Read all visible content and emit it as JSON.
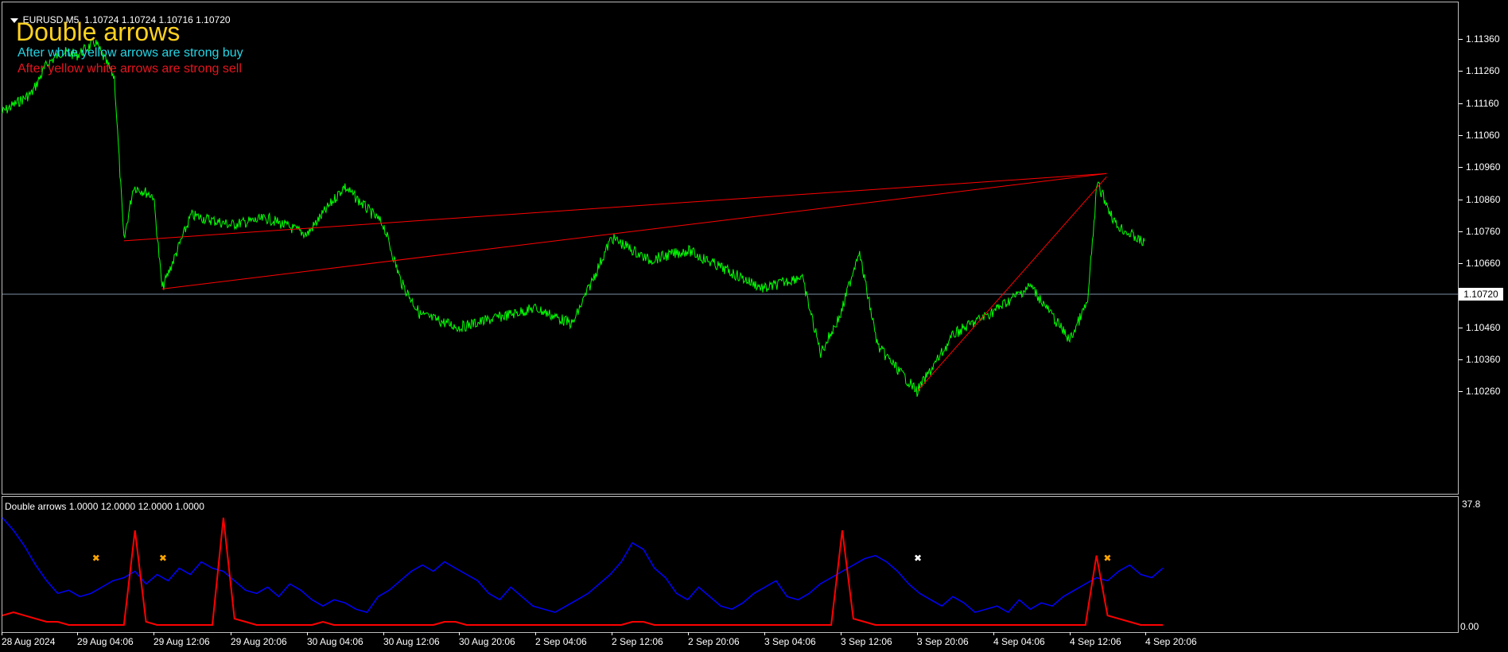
{
  "header": {
    "symbol": "EURUSD,M5",
    "ohlc": "1.10724 1.10724 1.10716 1.10720"
  },
  "overlay": {
    "title": "Double arrows",
    "buy_text": "After white yellow arrows are strong buy",
    "sell_text": "After yellow white arrows are strong sell"
  },
  "price_axis": [
    "1.11360",
    "1.11260",
    "1.11160",
    "1.11060",
    "1.10960",
    "1.10860",
    "1.10760",
    "1.10660",
    "1.10560",
    "1.10460",
    "1.10360",
    "1.10260"
  ],
  "current_price": "1.10720",
  "indicator": {
    "label": "Double arrows 1.0000 12.0000 12.0000 1.0000",
    "max_label": "37.8",
    "zero_label": "0.00"
  },
  "time_axis": [
    "28 Aug 2024",
    "29 Aug 04:06",
    "29 Aug 12:06",
    "29 Aug 20:06",
    "30 Aug 04:06",
    "30 Aug 12:06",
    "30 Aug 20:06",
    "2 Sep 04:06",
    "2 Sep 12:06",
    "2 Sep 20:06",
    "3 Sep 04:06",
    "3 Sep 12:06",
    "3 Sep 20:06",
    "4 Sep 04:06",
    "4 Sep 12:06",
    "4 Sep 20:06"
  ],
  "colors": {
    "price_line": "#00ff00",
    "trend_line": "#ff0000",
    "indicator_main": "#0000ff",
    "indicator_signal": "#ff0000",
    "arrow_yellow": "#ffa500",
    "arrow_white": "#ffffff",
    "grid_line": "#7a8fa6"
  },
  "chart_data": {
    "type": "line",
    "symbol": "EURUSD",
    "timeframe": "M5",
    "y_range": [
      1.1021,
      1.1142
    ],
    "price_series": [
      {
        "t": "28 Aug 2024",
        "p": 1.1113
      },
      {
        "t": "28 Aug 16:00",
        "p": 1.1119
      },
      {
        "t": "28 Aug 20:00",
        "p": 1.1128
      },
      {
        "t": "29 Aug 00:00",
        "p": 1.1132
      },
      {
        "t": "29 Aug 04:06",
        "p": 1.1131
      },
      {
        "t": "29 Aug 06:00",
        "p": 1.1135
      },
      {
        "t": "29 Aug 08:00",
        "p": 1.1124
      },
      {
        "t": "29 Aug 09:00",
        "p": 1.1073
      },
      {
        "t": "29 Aug 10:00",
        "p": 1.109
      },
      {
        "t": "29 Aug 12:06",
        "p": 1.1087
      },
      {
        "t": "29 Aug 13:00",
        "p": 1.1058
      },
      {
        "t": "29 Aug 16:00",
        "p": 1.1081
      },
      {
        "t": "29 Aug 20:06",
        "p": 1.1078
      },
      {
        "t": "30 Aug 00:00",
        "p": 1.108
      },
      {
        "t": "30 Aug 04:06",
        "p": 1.1075
      },
      {
        "t": "30 Aug 08:00",
        "p": 1.109
      },
      {
        "t": "30 Aug 12:06",
        "p": 1.1078
      },
      {
        "t": "30 Aug 14:00",
        "p": 1.106
      },
      {
        "t": "30 Aug 16:00",
        "p": 1.105
      },
      {
        "t": "30 Aug 20:06",
        "p": 1.1046
      },
      {
        "t": "2 Sep 04:06",
        "p": 1.1052
      },
      {
        "t": "2 Sep 08:00",
        "p": 1.1047
      },
      {
        "t": "2 Sep 12:06",
        "p": 1.1074
      },
      {
        "t": "2 Sep 16:00",
        "p": 1.1067
      },
      {
        "t": "2 Sep 20:06",
        "p": 1.107
      },
      {
        "t": "3 Sep 00:00",
        "p": 1.1064
      },
      {
        "t": "3 Sep 04:06",
        "p": 1.1058
      },
      {
        "t": "3 Sep 08:00",
        "p": 1.1062
      },
      {
        "t": "3 Sep 10:00",
        "p": 1.1038
      },
      {
        "t": "3 Sep 12:06",
        "p": 1.105
      },
      {
        "t": "3 Sep 14:00",
        "p": 1.107
      },
      {
        "t": "3 Sep 16:00",
        "p": 1.104
      },
      {
        "t": "3 Sep 20:06",
        "p": 1.1026
      },
      {
        "t": "4 Sep 00:00",
        "p": 1.1044
      },
      {
        "t": "4 Sep 04:06",
        "p": 1.1051
      },
      {
        "t": "4 Sep 08:00",
        "p": 1.1059
      },
      {
        "t": "4 Sep 12:06",
        "p": 1.1042
      },
      {
        "t": "4 Sep 14:00",
        "p": 1.1054
      },
      {
        "t": "4 Sep 15:00",
        "p": 1.1091
      },
      {
        "t": "4 Sep 17:00",
        "p": 1.1078
      },
      {
        "t": "4 Sep 20:06",
        "p": 1.1072
      }
    ],
    "trend_lines": [
      {
        "from": {
          "t": "29 Aug 09:00",
          "p": 1.1073
        },
        "to": {
          "t": "4 Sep 16:00",
          "p": 1.1094
        }
      },
      {
        "from": {
          "t": "29 Aug 13:00",
          "p": 1.1058
        },
        "to": {
          "t": "4 Sep 16:00",
          "p": 1.1094
        }
      },
      {
        "from": {
          "t": "3 Sep 20:06",
          "p": 1.1026
        },
        "to": {
          "t": "4 Sep 16:00",
          "p": 1.1093
        }
      }
    ],
    "indicator_range": [
      0,
      37.8
    ],
    "indicator_main": [
      34,
      30,
      25,
      19,
      14,
      10,
      11,
      9,
      10,
      12,
      14,
      15,
      17,
      13,
      16,
      14,
      18,
      16,
      20,
      18,
      17,
      14,
      11,
      10,
      12,
      9,
      13,
      11,
      8,
      6,
      8,
      7,
      5,
      4,
      9,
      11,
      14,
      17,
      19,
      17,
      20,
      18,
      16,
      14,
      10,
      8,
      12,
      9,
      6,
      5,
      4,
      6,
      8,
      10,
      13,
      16,
      20,
      26,
      24,
      18,
      15,
      10,
      8,
      12,
      9,
      6,
      5,
      7,
      10,
      12,
      14,
      9,
      8,
      10,
      13,
      15,
      17,
      19,
      21,
      22,
      20,
      17,
      13,
      10,
      8,
      6,
      9,
      7,
      4,
      5,
      6,
      4,
      8,
      5,
      7,
      6,
      9,
      11,
      13,
      15,
      14,
      17,
      19,
      16,
      15,
      18
    ],
    "indicator_signal": [
      3,
      4,
      3,
      2,
      1,
      1,
      0,
      0,
      0,
      0,
      0,
      0,
      30,
      1,
      0,
      0,
      0,
      0,
      0,
      0,
      34,
      2,
      1,
      0,
      0,
      0,
      0,
      0,
      0,
      1,
      0,
      0,
      0,
      0,
      0,
      0,
      0,
      0,
      0,
      0,
      1,
      1,
      0,
      0,
      0,
      0,
      0,
      0,
      0,
      0,
      0,
      0,
      0,
      0,
      0,
      0,
      0,
      1,
      1,
      0,
      0,
      0,
      0,
      0,
      0,
      0,
      0,
      0,
      0,
      0,
      0,
      0,
      0,
      0,
      0,
      0,
      30,
      2,
      1,
      0,
      0,
      0,
      0,
      0,
      0,
      0,
      0,
      0,
      0,
      0,
      0,
      0,
      0,
      0,
      0,
      0,
      0,
      0,
      0,
      22,
      3,
      2,
      1,
      0,
      0,
      0
    ],
    "arrows": [
      {
        "t": "29 Aug 06:00",
        "color": "yellow"
      },
      {
        "t": "29 Aug 13:00",
        "color": "yellow"
      },
      {
        "t": "3 Sep 20:06",
        "color": "white"
      },
      {
        "t": "4 Sep 16:00",
        "color": "yellow"
      }
    ]
  }
}
